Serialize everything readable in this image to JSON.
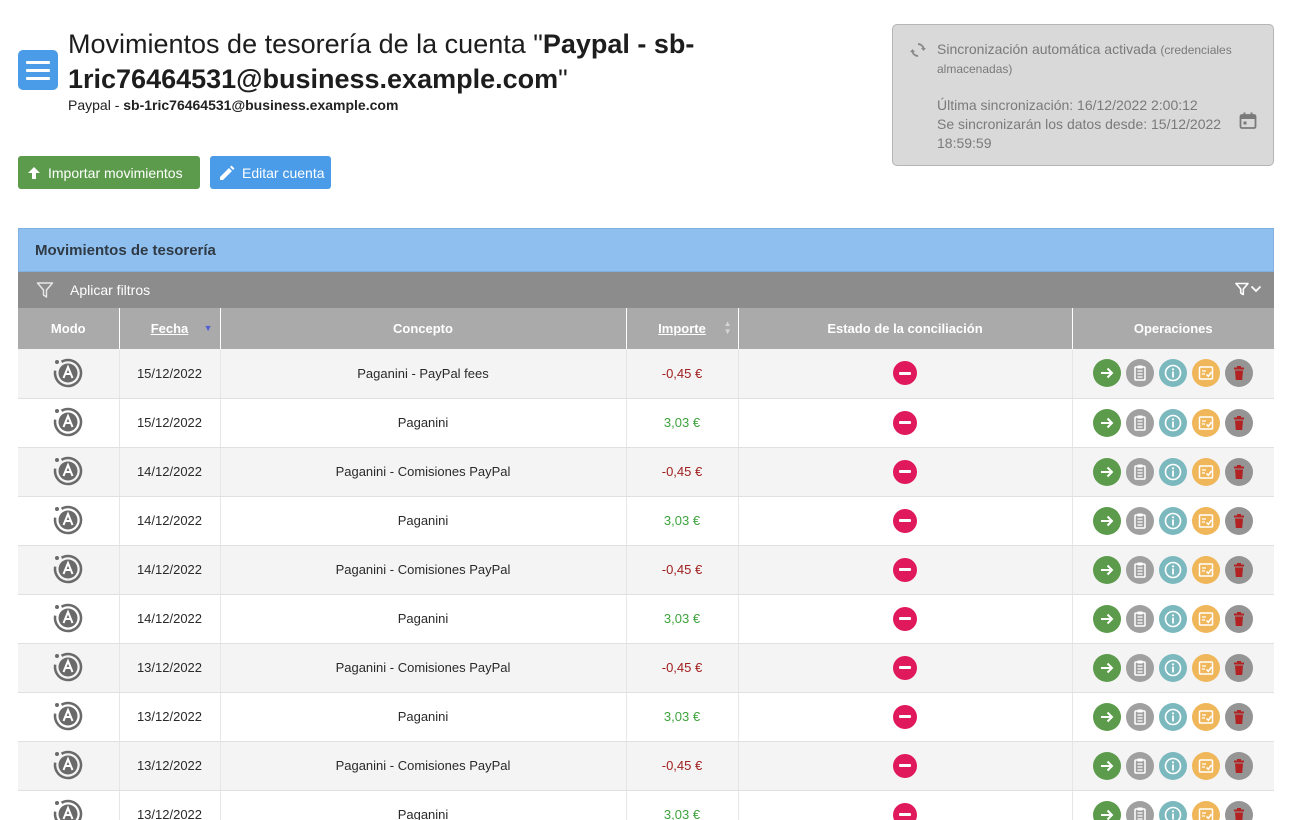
{
  "header": {
    "title_prefix": "Movimientos de tesorería de la cuenta \"",
    "title_bold": "Paypal - sb-1ric76464531@business.example.com",
    "title_suffix": "\"",
    "subtitle_prefix": "Paypal - ",
    "subtitle_bold": "sb-1ric76464531@business.example.com"
  },
  "buttons": {
    "import_label": "Importar movimientos",
    "edit_label": "Editar cuenta"
  },
  "sync": {
    "status": "Sincronización automática activada",
    "status_note": "(credenciales almacenadas)",
    "last_sync": "Última sincronización: 16/12/2022 2:00:12",
    "since": "Se sincronizarán los datos desde: 15/12/2022 18:59:59"
  },
  "panel": {
    "title": "Movimientos de tesorería",
    "filter_label": "Aplicar filtros"
  },
  "table": {
    "columns": {
      "modo": "Modo",
      "fecha": "Fecha",
      "concepto": "Concepto",
      "importe": "Importe",
      "estado": "Estado de la conciliación",
      "operaciones": "Operaciones"
    },
    "rows": [
      {
        "fecha": "15/12/2022",
        "concepto": "Paganini - PayPal fees",
        "importe": "-0,45 €",
        "sign": "neg"
      },
      {
        "fecha": "15/12/2022",
        "concepto": "Paganini",
        "importe": "3,03 €",
        "sign": "pos"
      },
      {
        "fecha": "14/12/2022",
        "concepto": "Paganini - Comisiones PayPal",
        "importe": "-0,45 €",
        "sign": "neg"
      },
      {
        "fecha": "14/12/2022",
        "concepto": "Paganini",
        "importe": "3,03 €",
        "sign": "pos"
      },
      {
        "fecha": "14/12/2022",
        "concepto": "Paganini - Comisiones PayPal",
        "importe": "-0,45 €",
        "sign": "neg"
      },
      {
        "fecha": "14/12/2022",
        "concepto": "Paganini",
        "importe": "3,03 €",
        "sign": "pos"
      },
      {
        "fecha": "13/12/2022",
        "concepto": "Paganini - Comisiones PayPal",
        "importe": "-0,45 €",
        "sign": "neg"
      },
      {
        "fecha": "13/12/2022",
        "concepto": "Paganini",
        "importe": "3,03 €",
        "sign": "pos"
      },
      {
        "fecha": "13/12/2022",
        "concepto": "Paganini - Comisiones PayPal",
        "importe": "-0,45 €",
        "sign": "neg"
      },
      {
        "fecha": "13/12/2022",
        "concepto": "Paganini",
        "importe": "3,03 €",
        "sign": "pos"
      }
    ]
  },
  "icons": {
    "menu": "hamburger-menu-icon",
    "import": "upload-arrow-icon",
    "edit": "pencil-icon",
    "sync": "sync-icon",
    "calendar": "calendar-icon",
    "filter": "filter-icon",
    "mode": "automatic-mode-icon",
    "status": "not-reconciled-icon",
    "ops": [
      "arrow-right-icon",
      "notes-icon",
      "info-icon",
      "edit-checklist-icon",
      "trash-icon"
    ]
  },
  "colors": {
    "primary": "#4a9be8",
    "success": "#5b9b4b",
    "negative": "#a02020",
    "positive": "#3da33d",
    "status_unreconciled": "#e0185c",
    "panel_header": "#8fbfef"
  }
}
